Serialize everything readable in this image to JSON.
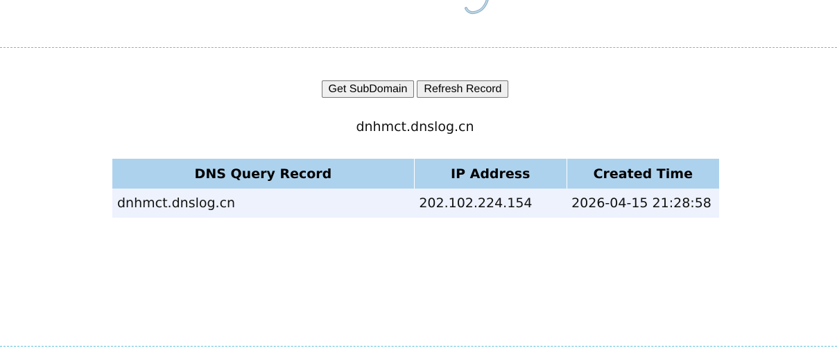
{
  "actions": {
    "get_subdomain_label": "Get SubDomain",
    "refresh_record_label": "Refresh Record"
  },
  "current_subdomain": "dnhmct.dnslog.cn",
  "table": {
    "headers": [
      "DNS Query Record",
      "IP Address",
      "Created Time"
    ],
    "rows": [
      {
        "dns_query_record": "dnhmct.dnslog.cn",
        "ip_address": "202.102.224.154",
        "created_time": "2026-04-15 21:28:58"
      }
    ]
  },
  "colors": {
    "header_bg": "#add2ed",
    "row_bg": "#edf2fd",
    "divider": "#5cc2dd"
  },
  "icons": {
    "logo_fragment": "logo-curl-icon"
  }
}
